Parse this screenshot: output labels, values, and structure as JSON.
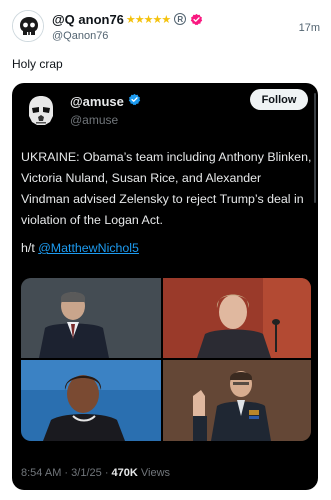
{
  "post": {
    "display_name": "@Q anon76",
    "stars": "★★★★★",
    "registered_mark": "R",
    "handle": "@Qanon76",
    "time": "17m",
    "text": "Holy crap"
  },
  "embed": {
    "display_name": "@amuse",
    "handle": "@amuse",
    "follow_label": "Follow",
    "body": "UKRAINE: Obama’s team including Anthony Blinken, Victoria Nuland, Susan Rice, and Alexander Vindman advised Zelensky to reject Trump’s deal in violation of the Logan Act.",
    "ht_prefix": "h/t ",
    "ht_mention": "@MatthewNichol5",
    "time": "8:54 AM",
    "separator": "·",
    "date": "3/1/25",
    "views_count": "470K",
    "views_label": "Views"
  },
  "colors": {
    "verified_blue": "#1d9bf0",
    "badge_pink": "#f91880",
    "star_gold": "#f4c20d",
    "card_bg": "#000000",
    "link_blue": "#1d9bf0"
  },
  "icons": {
    "avatar": "skull-sticker-icon",
    "embed_avatar": "stormtrooper-helmet-icon",
    "verified": "verified-checkmark-icon",
    "badge": "pink-checkmark-badge-icon"
  }
}
